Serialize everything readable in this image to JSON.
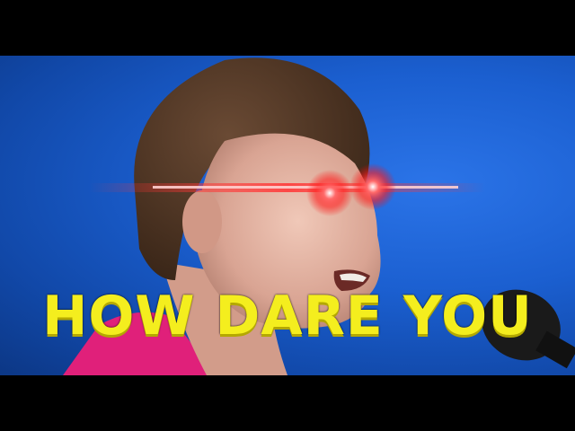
{
  "meme": {
    "caption": "HOW DARE YOU"
  },
  "colors": {
    "caption": "#f4ee1e",
    "background": "#1b5fd0",
    "laser": "#ff2a2a",
    "shirt": "#e0207a"
  },
  "icons": {
    "microphone": "microphone-icon"
  }
}
